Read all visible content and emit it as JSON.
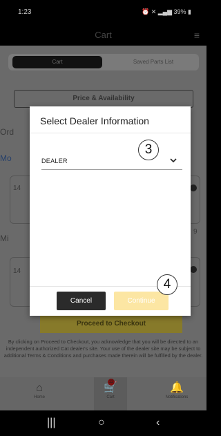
{
  "status": {
    "time": "1:23",
    "battery": "39%"
  },
  "header": {
    "title": "Cart",
    "menu_icon": "hamburger-menu-icon"
  },
  "tabs": {
    "active": "Cart",
    "other": "Saved Parts List"
  },
  "page": {
    "price_button": "Price & Availability",
    "partial_labels": [
      "Ord",
      "Mo",
      "14",
      "Mi",
      "14"
    ],
    "partial_value": "9",
    "checkout_button": "Proceed to Checkout",
    "disclaimer": "By clicking on Proceed to Checkout, you acknowledge that you will be directed to an independent authorized Cat dealer's site. Your use of the dealer site may be subject to additional Terms & Conditions and purchases made therein will be fulfilled by the dealer."
  },
  "bottom_nav": {
    "home": "Home",
    "cart": "Cart",
    "cart_badge": "12",
    "notifications": "Notifications"
  },
  "modal": {
    "title": "Select Dealer Information",
    "dealer_label": "DEALER",
    "cancel": "Cancel",
    "continue": "Continue"
  },
  "callouts": {
    "step3": "3",
    "step4": "4"
  },
  "colors": {
    "accent": "#ffcc33",
    "continue_disabled": "#fce6a3",
    "cancel_bg": "#2b2b2b"
  }
}
